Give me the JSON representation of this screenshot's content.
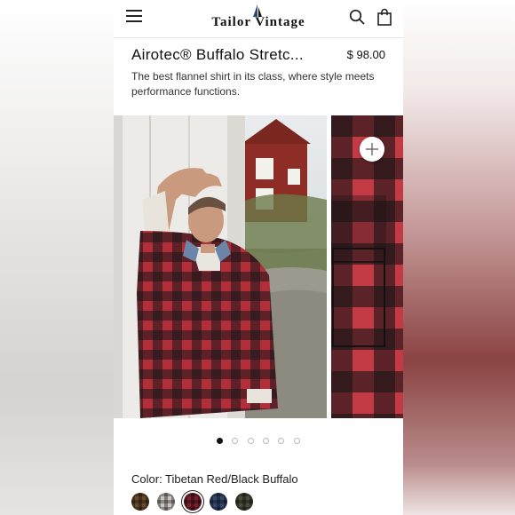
{
  "header": {
    "logo_text": "Tailor Vintage",
    "icons": [
      "menu-icon",
      "sail-icon",
      "search-icon",
      "bag-icon"
    ]
  },
  "product": {
    "title": "Airotec® Buffalo Stretc...",
    "price": "$ 98.00",
    "description": "The best flannel shirt in its class, where style meets performance functions."
  },
  "carousel": {
    "slide_count": 6,
    "active_index": 0,
    "zoom_icon": "plus-icon"
  },
  "color": {
    "label": "Color: Tibetan Red/Black Buffalo",
    "selected_index": 2,
    "swatches": [
      {
        "name": "brown-plaid",
        "color": "#6b4a2a"
      },
      {
        "name": "grey-plaid",
        "color": "#c9c4bd"
      },
      {
        "name": "tibetan-red-black-buffalo",
        "color": "#7a1f2b"
      },
      {
        "name": "navy-plaid",
        "color": "#34486b"
      },
      {
        "name": "olive-plaid",
        "color": "#4b4e3e"
      }
    ]
  },
  "colors": {
    "accent": "#111111",
    "flannel_red": "#b5303a",
    "flannel_black": "#1b1416"
  }
}
